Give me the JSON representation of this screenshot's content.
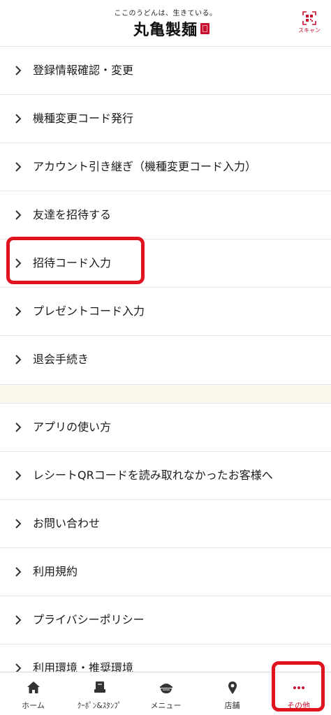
{
  "header": {
    "tagline": "ここのうどんは、生きている。",
    "logo": "丸亀製麺",
    "scan_label": "スキャン"
  },
  "menu": {
    "items": [
      {
        "label": "登録情報確認・変更"
      },
      {
        "label": "機種変更コード発行"
      },
      {
        "label": "アカウント引き継ぎ（機種変更コード入力）"
      },
      {
        "label": "友達を招待する"
      },
      {
        "label": "招待コード入力"
      },
      {
        "label": "プレゼントコード入力"
      },
      {
        "label": "退会手続き"
      },
      {
        "label": "アプリの使い方"
      },
      {
        "label": "レシートQRコードを読み取れなかったお客様へ"
      },
      {
        "label": "お問い合わせ"
      },
      {
        "label": "利用規約"
      },
      {
        "label": "プライバシーポリシー"
      },
      {
        "label": "利用環境・推奨環境"
      }
    ]
  },
  "tabbar": {
    "tabs": [
      {
        "label": "ホーム",
        "icon": "home-icon"
      },
      {
        "label": "ｸｰﾎﾟﾝ&ｽﾀﾝﾌﾟ",
        "icon": "coupon-icon"
      },
      {
        "label": "メニュー",
        "icon": "bowl-icon"
      },
      {
        "label": "店舗",
        "icon": "map-pin-icon"
      },
      {
        "label": "その他",
        "icon": "more-dots-icon",
        "active": true
      }
    ]
  },
  "colors": {
    "brand_red": "#c8102e",
    "highlight_red": "#e0141e",
    "section_bg": "#faf6ea"
  }
}
